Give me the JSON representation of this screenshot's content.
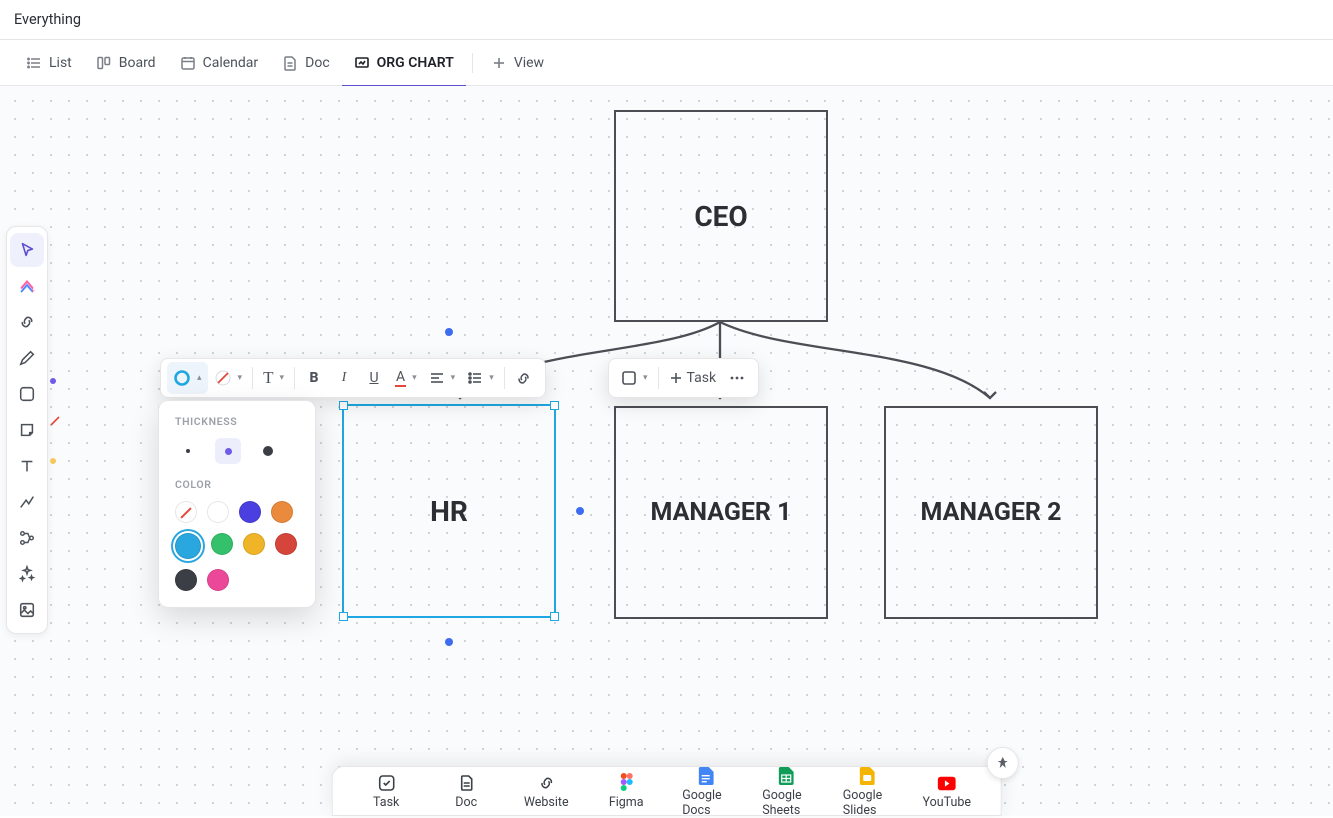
{
  "title": "Everything",
  "views": {
    "list": "List",
    "board": "Board",
    "calendar": "Calendar",
    "doc": "Doc",
    "org_chart": "ORG CHART",
    "add_view": "View"
  },
  "toolbar": {
    "task_label": "Task"
  },
  "popover": {
    "thickness_label": "THICKNESS",
    "color_label": "COLOR",
    "thickness_options": [
      "thin",
      "medium",
      "thick"
    ],
    "thickness_selected": "medium",
    "colors": [
      {
        "name": "none",
        "hex": "none"
      },
      {
        "name": "white",
        "hex": "#ffffff"
      },
      {
        "name": "indigo",
        "hex": "#4b3fe0"
      },
      {
        "name": "orange",
        "hex": "#e98a3c"
      },
      {
        "name": "sky",
        "hex": "#2aa7de"
      },
      {
        "name": "green",
        "hex": "#35c16b"
      },
      {
        "name": "amber",
        "hex": "#f0b429"
      },
      {
        "name": "red",
        "hex": "#d6453a"
      },
      {
        "name": "charcoal",
        "hex": "#3b3e44"
      },
      {
        "name": "pink",
        "hex": "#ec4899"
      }
    ],
    "color_selected": "sky"
  },
  "dots": {
    "purple": "#6c5ce7",
    "red_slash": "#e4483a",
    "yellow": "#f4c95d"
  },
  "nodes": {
    "ceo": "CEO",
    "hr": "HR",
    "manager1": "MANAGER 1",
    "manager2": "MANAGER 2"
  },
  "addbar": {
    "task": "Task",
    "doc": "Doc",
    "website": "Website",
    "figma": "Figma",
    "gdocs": "Google Docs",
    "gsheets": "Google Sheets",
    "gslides": "Google Slides",
    "youtube": "YouTube"
  }
}
